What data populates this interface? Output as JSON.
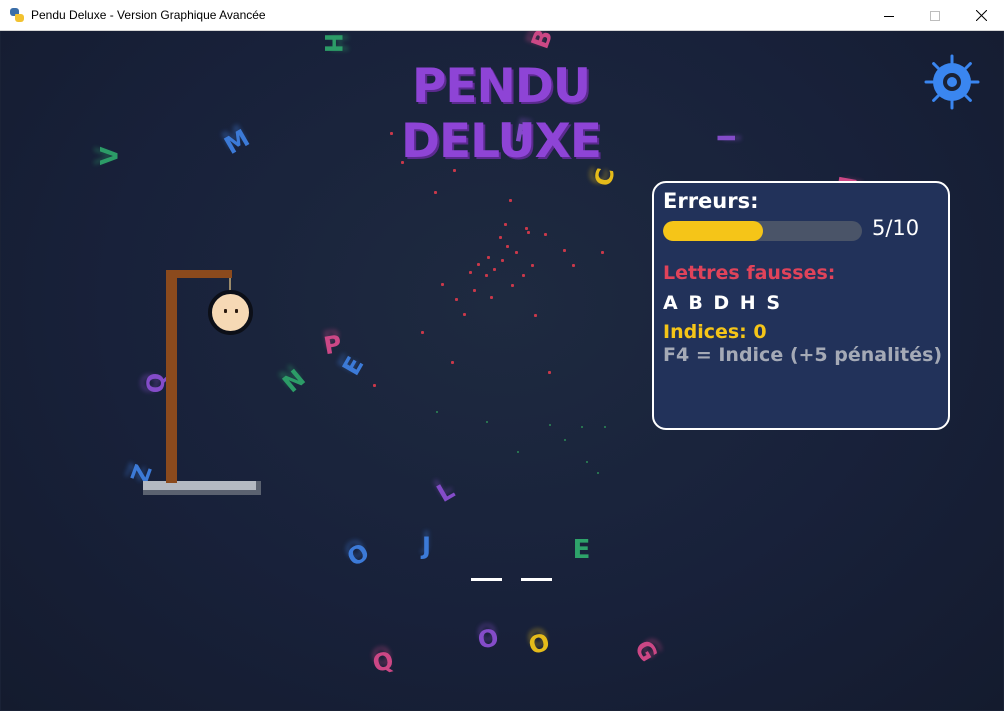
{
  "window": {
    "title": "Pendu Deluxe - Version Graphique Avancée",
    "controls": [
      "minimize",
      "maximize",
      "close"
    ]
  },
  "game": {
    "title": "PENDU DELUXE",
    "settings_icon": "gear-icon",
    "panel": {
      "errors_label": "Erreurs:",
      "errors_count": "5/10",
      "errors_value": 5,
      "errors_max": 10,
      "wrong_letters_label": "Lettres fausses:",
      "wrong_letters": "A B D H S",
      "hints_label": "Indices: 0",
      "hint_help": "F4 = Indice (+5 pénalités)"
    },
    "word": {
      "slots": [
        "",
        "",
        "E"
      ]
    },
    "floating_letters": [
      "H",
      "B",
      "V",
      "M",
      "F",
      "C",
      "I",
      "D",
      "P",
      "N",
      "E",
      "Q",
      "Z",
      "L",
      "O",
      "J",
      "O",
      "O",
      "Q",
      "G"
    ],
    "colors": {
      "title": "#8e44d6",
      "progress": "#f5c518",
      "wrong": "#e0435a",
      "hints": "#f5c518",
      "background": "#18213a"
    }
  }
}
